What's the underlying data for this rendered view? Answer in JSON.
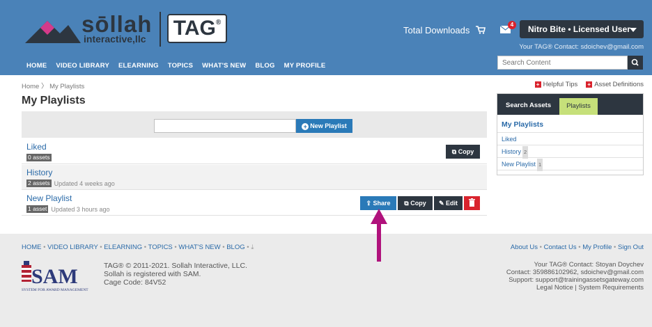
{
  "header": {
    "logo_brand": "sōllah",
    "logo_sub": "interactive,llc",
    "logo_tag": "TAG",
    "logo_tag_reg": "®",
    "total_downloads_label": "Total Downloads",
    "mail_badge": "4",
    "user_name": "Nitro Bite • Licensed User",
    "tag_contact": "Your TAG® Contact: sdoichev@gmail.com",
    "search_placeholder": "Search Content",
    "nav": [
      "HOME",
      "VIDEO LIBRARY",
      "ELEARNING",
      "TOPICS",
      "WHAT'S NEW",
      "BLOG",
      "MY PROFILE"
    ]
  },
  "breadcrumb": {
    "home": "Home",
    "current": "My Playlists"
  },
  "helpful": {
    "tips": "Helpful Tips",
    "definitions": "Asset Definitions"
  },
  "page_title": "My Playlists",
  "new_playlist_button": "New Playlist",
  "playlists": [
    {
      "name": "Liked",
      "badge": "0 assets",
      "updated": "",
      "actions": {
        "copy": "Copy"
      }
    },
    {
      "name": "History",
      "badge": "2 assets",
      "updated": "Updated 4 weeks ago"
    },
    {
      "name": "New Playlist",
      "badge": "1 asset",
      "updated": "Updated 3 hours ago",
      "actions": {
        "share": "Share",
        "copy": "Copy",
        "edit": "Edit"
      }
    }
  ],
  "sidebar": {
    "tab_search": "Search Assets",
    "tab_playlists": "Playlists",
    "heading": "My Playlists",
    "items": [
      {
        "label": "Liked",
        "count": ""
      },
      {
        "label": "History",
        "count": "2"
      },
      {
        "label": "New Playlist",
        "count": "1"
      }
    ]
  },
  "footer": {
    "links": [
      "HOME",
      "VIDEO LIBRARY",
      "ELEARNING",
      "TOPICS",
      "WHAT'S NEW",
      "BLOG"
    ],
    "right_links": [
      "About Us",
      "Contact Us",
      "My Profile",
      "Sign Out"
    ],
    "copyright_1": "TAG® © 2011-2021. Sollah Interactive, LLC.",
    "copyright_2": "Sollah is registered with SAM.",
    "copyright_3": "Cage Code: 84V52",
    "contact_1": "Your TAG® Contact: Stoyan Doychev",
    "contact_2_label": "Contact:",
    "contact_2": "359886102962, sdoichev@gmail.com",
    "contact_3_label": "Support:",
    "contact_3": "support@trainingassetsgateway.com",
    "contact_4": "Legal Notice | System Requirements",
    "sam_text": "SAM",
    "sam_sub": "SYSTEM FOR AWARD MANAGEMENT"
  },
  "colors": {
    "header_blue": "#4a82b8",
    "dark_navy": "#2d3640",
    "action_blue": "#2a7ab8",
    "danger_red": "#d9232d",
    "tab_green": "#c6e07a",
    "annotation_magenta": "#b0127c"
  }
}
